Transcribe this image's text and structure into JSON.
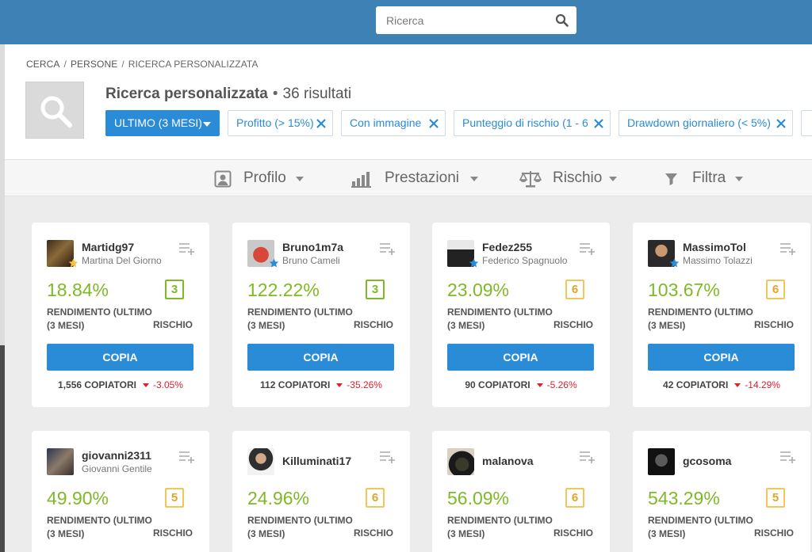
{
  "search": {
    "placeholder": "Ricerca"
  },
  "breadcrumb": [
    "CERCA",
    "PERSONE",
    "RICERCA PERSONALIZZATA"
  ],
  "header": {
    "title": "Ricerca personalizzata",
    "results": "36 risultati"
  },
  "filters": {
    "period": "ULTIMO (3 MESI)",
    "chips": [
      "Profitto (> 15%)",
      "Con immagine",
      "Punteggio di rischio (1 - 6",
      "Drawdown giornaliero (< 5%)"
    ]
  },
  "tabs": [
    {
      "label": "Profilo",
      "icon": "profile-icon"
    },
    {
      "label": "Prestazioni",
      "icon": "bar-chart-icon"
    },
    {
      "label": "Rischio",
      "icon": "scale-icon"
    },
    {
      "label": "Filtra",
      "icon": "funnel-icon"
    }
  ],
  "card_labels": {
    "return_line1": "RENDIMENTO (ULTIMO",
    "return_line2": "(3 MESI)",
    "risk": "RISCHIO",
    "copy": "COPIA",
    "copiers": "COPIATORI"
  },
  "colors": {
    "topbar": "#3d81b5",
    "accent": "#2a8bd7",
    "gain": "#80b928",
    "risk_low": "#80b928",
    "risk_mid": "#f3c65a",
    "negative": "#d8222e",
    "star_gold": "#f5c244",
    "star_blue": "#2a8bd7"
  },
  "traders": [
    {
      "username": "Martidg97",
      "fullname": "Martina Del Giorno",
      "gain": "18.84%",
      "risk": "3",
      "copiers": "1,556",
      "change": "-3.05%",
      "star": "gold"
    },
    {
      "username": "Bruno1m7a",
      "fullname": "Bruno Cameli",
      "gain": "122.22%",
      "risk": "3",
      "copiers": "112",
      "change": "-35.26%",
      "star": "blue"
    },
    {
      "username": "Fedez255",
      "fullname": "Federico Spagnuolo",
      "gain": "23.09%",
      "risk": "6",
      "copiers": "90",
      "change": "-5.26%",
      "star": "blue"
    },
    {
      "username": "MassimoTol",
      "fullname": "Massimo Tolazzi",
      "gain": "103.67%",
      "risk": "6",
      "copiers": "42",
      "change": "-14.29%",
      "star": "blue"
    },
    {
      "username": "giovanni2311",
      "fullname": "Giovanni Gentile",
      "gain": "49.90%",
      "risk": "5"
    },
    {
      "username": "Killuminati17",
      "fullname": "",
      "gain": "24.96%",
      "risk": "6"
    },
    {
      "username": "malanova",
      "fullname": "",
      "gain": "56.09%",
      "risk": "6"
    },
    {
      "username": "gcosoma",
      "fullname": "",
      "gain": "543.29%",
      "risk": "5"
    }
  ]
}
